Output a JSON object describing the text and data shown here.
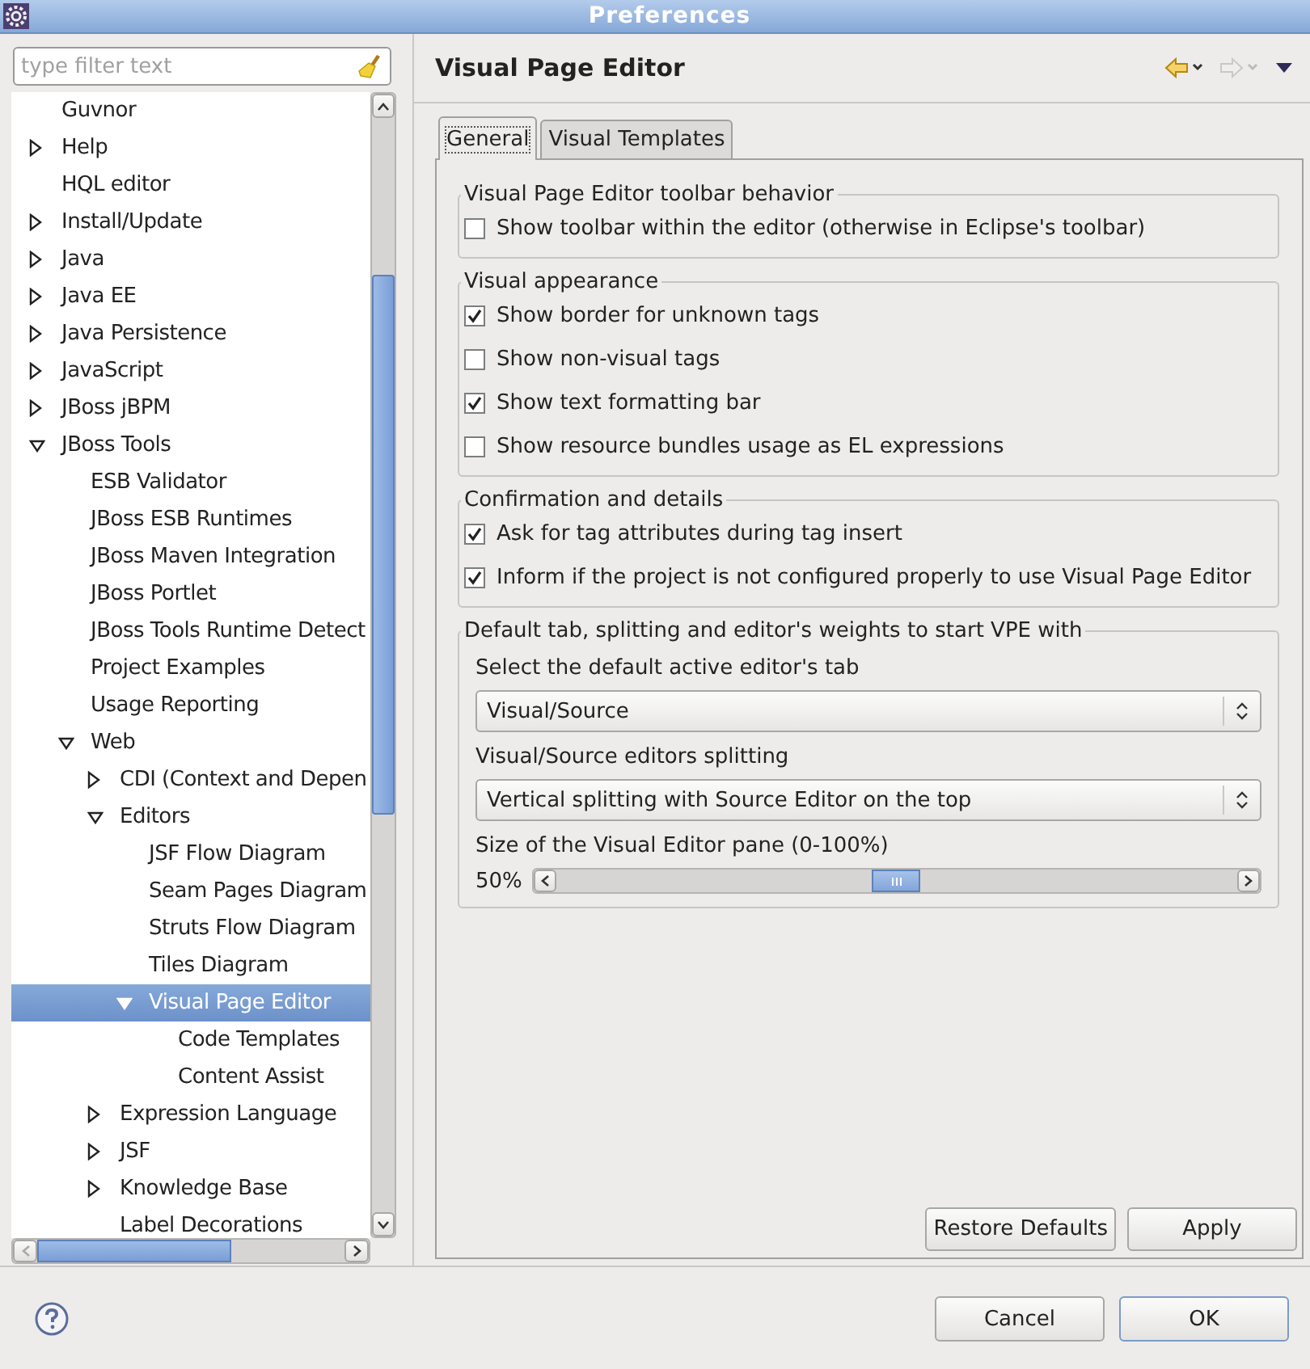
{
  "window": {
    "title": "Preferences"
  },
  "filter": {
    "placeholder": "type filter text"
  },
  "tree": {
    "items": [
      {
        "label": "Guvnor",
        "selected": false
      },
      {
        "label": "Help",
        "expanded": false,
        "selected": false
      },
      {
        "label": "HQL editor",
        "selected": false
      },
      {
        "label": "Install/Update",
        "expanded": false,
        "selected": false
      },
      {
        "label": "Java",
        "expanded": false,
        "selected": false
      },
      {
        "label": "Java EE",
        "expanded": false,
        "selected": false
      },
      {
        "label": "Java Persistence",
        "expanded": false,
        "selected": false
      },
      {
        "label": "JavaScript",
        "expanded": false,
        "selected": false
      },
      {
        "label": "JBoss jBPM",
        "expanded": false,
        "selected": false
      },
      {
        "label": "JBoss Tools",
        "expanded": true,
        "selected": false,
        "children": [
          {
            "label": "ESB Validator",
            "selected": false
          },
          {
            "label": "JBoss ESB Runtimes",
            "selected": false
          },
          {
            "label": "JBoss Maven Integration",
            "selected": false
          },
          {
            "label": "JBoss Portlet",
            "selected": false
          },
          {
            "label": "JBoss Tools Runtime Detect",
            "selected": false
          },
          {
            "label": "Project Examples",
            "selected": false
          },
          {
            "label": "Usage Reporting",
            "selected": false
          },
          {
            "label": "Web",
            "expanded": true,
            "selected": false,
            "children": [
              {
                "label": "CDI (Context and Depen",
                "expanded": false,
                "selected": false
              },
              {
                "label": "Editors",
                "expanded": true,
                "selected": false,
                "children": [
                  {
                    "label": "JSF Flow Diagram",
                    "selected": false
                  },
                  {
                    "label": "Seam Pages Diagram",
                    "selected": false
                  },
                  {
                    "label": "Struts Flow Diagram",
                    "selected": false
                  },
                  {
                    "label": "Tiles Diagram",
                    "selected": false
                  },
                  {
                    "label": "Visual Page Editor",
                    "expanded": true,
                    "selected": true,
                    "children": [
                      {
                        "label": "Code Templates",
                        "selected": false
                      },
                      {
                        "label": "Content Assist",
                        "selected": false
                      }
                    ]
                  }
                ]
              },
              {
                "label": "Expression Language",
                "expanded": false,
                "selected": false
              },
              {
                "label": "JSF",
                "expanded": false,
                "selected": false
              },
              {
                "label": "Knowledge Base",
                "expanded": false,
                "selected": false
              },
              {
                "label": "Label Decorations",
                "selected": false
              }
            ]
          }
        ]
      }
    ]
  },
  "page": {
    "title": "Visual Page Editor"
  },
  "tabs": [
    {
      "label": "General",
      "selected": true
    },
    {
      "label": "Visual Templates",
      "selected": false
    }
  ],
  "groups": [
    {
      "title": "Visual Page Editor toolbar behavior",
      "items": [
        {
          "kind": "checkbox",
          "label": "Show toolbar within the editor (otherwise in Eclipse's toolbar)",
          "checked": false
        }
      ]
    },
    {
      "title": "Visual appearance",
      "items": [
        {
          "kind": "checkbox",
          "label": "Show border for unknown tags",
          "checked": true
        },
        {
          "kind": "checkbox",
          "label": "Show non-visual tags",
          "checked": false
        },
        {
          "kind": "checkbox",
          "label": "Show text formatting bar",
          "checked": true
        },
        {
          "kind": "checkbox",
          "label": "Show resource bundles usage as EL expressions",
          "checked": false
        }
      ]
    },
    {
      "title": "Confirmation and details",
      "items": [
        {
          "kind": "checkbox",
          "label": "Ask for tag attributes during tag insert",
          "checked": true
        },
        {
          "kind": "checkbox",
          "label": "Inform if the project is not configured properly to use Visual Page Editor",
          "checked": true
        }
      ]
    },
    {
      "title": "Default tab, splitting and editor's weights to start VPE with",
      "items": [
        {
          "kind": "label",
          "label": "Select the default active editor's tab"
        },
        {
          "kind": "select",
          "value": "Visual/Source"
        },
        {
          "kind": "label",
          "label": "Visual/Source editors splitting"
        },
        {
          "kind": "select",
          "value": "Vertical splitting with Source Editor on the top"
        },
        {
          "kind": "label",
          "label": "Size of the Visual Editor pane (0-100%)"
        },
        {
          "kind": "slider",
          "reading": "50%",
          "level": 0.5
        }
      ]
    }
  ],
  "page_buttons": [
    "Restore Defaults",
    "Apply"
  ],
  "dialog_buttons": [
    {
      "label": "Cancel",
      "default": false
    },
    {
      "label": "OK",
      "default": true
    }
  ]
}
